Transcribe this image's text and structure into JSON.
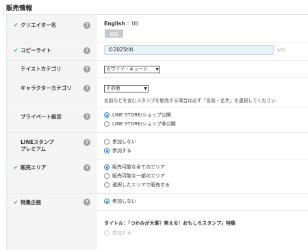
{
  "section": {
    "title": "販売情報"
  },
  "creator": {
    "label": "クリエイター名",
    "lang": "English",
    "name": "：titi",
    "edit_label": "編集"
  },
  "copyright": {
    "label": "コピーライト",
    "value": "©2025titi",
    "counter": "9/50"
  },
  "taste": {
    "label": "テイストカテゴリ",
    "selected": "カワイイ・キュート"
  },
  "character": {
    "label": "キャラクターカテゴリ",
    "selected": "その他",
    "note": "名前などを含むスタンプを販売する場合は必ず「名前・名字」を選択してください"
  },
  "privacy": {
    "label": "プライベート設定",
    "options": [
      "LINE STORE/ショップ公開",
      "LINE STORE/ショップ非公開"
    ]
  },
  "premium": {
    "label_line1": "LINEスタンプ",
    "label_line2": "プレミアム",
    "options": [
      "参加しない",
      "参加する"
    ]
  },
  "area": {
    "label": "販売エリア",
    "options": [
      "販売可能な全てのエリア",
      "販売可能な一部のエリア",
      "選択したエリアで販売する"
    ]
  },
  "campaign": {
    "label": "特集企画",
    "option_none": "参加しない",
    "subtitle": "タイトル：「つかみが大事？笑える！おもしろスタンプ」特集",
    "option_join": "参加する"
  },
  "colors": {
    "check": "#2ab36d",
    "radio_on": "#1a73e8",
    "input_bg": "#e9f1fb"
  }
}
